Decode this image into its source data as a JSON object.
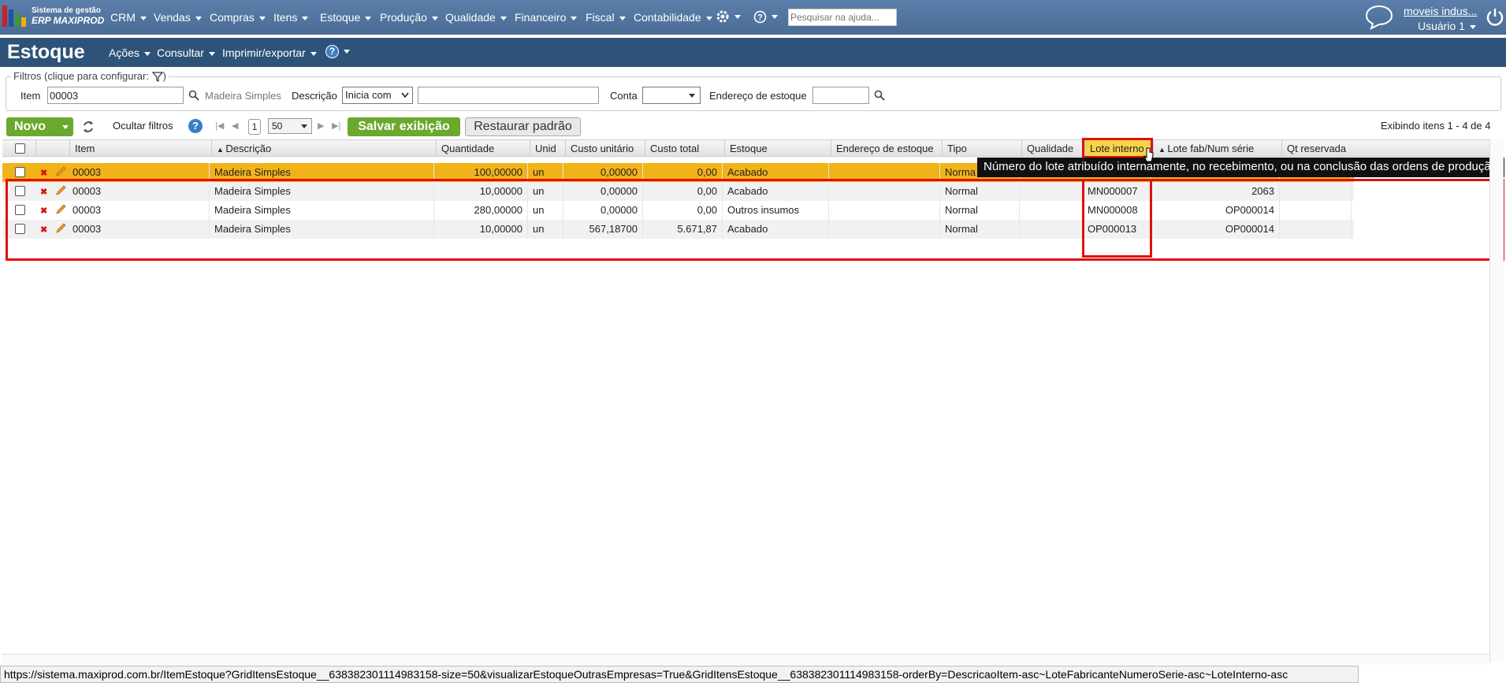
{
  "app": {
    "title_line1": "Sistema de gestão",
    "title_line2": "ERP MAXIPROD"
  },
  "menu": [
    "CRM",
    "Vendas",
    "Compras",
    "Itens",
    "Estoque",
    "Produção",
    "Qualidade",
    "Financeiro",
    "Fiscal",
    "Contabilidade"
  ],
  "search": {
    "placeholder": "Pesquisar na ajuda..."
  },
  "user": {
    "company": "moveis indus...",
    "name": "Usuário 1"
  },
  "page": {
    "title": "Estoque",
    "submenu": [
      "Ações",
      "Consultar",
      "Imprimir/exportar"
    ]
  },
  "filters": {
    "legend": "Filtros (clique para configurar:",
    "item_label": "Item",
    "item_value": "00003",
    "item_desc": "Madeira Simples",
    "desc_label": "Descrição",
    "desc_mode": "Inicia com",
    "desc_value": "",
    "conta_label": "Conta",
    "conta_value": "",
    "endereco_label": "Endereço de estoque",
    "endereco_value": ""
  },
  "toolbar": {
    "novo": "Novo",
    "ocultar": "Ocultar filtros",
    "page": "1",
    "page_size": "50",
    "salvar": "Salvar exibição",
    "restaurar": "Restaurar padrão",
    "exibindo": "Exibindo itens 1 - 4 de 4"
  },
  "columns": [
    "Item",
    "Descrição",
    "Quantidade",
    "Unid",
    "Custo unitário",
    "Custo total",
    "Estoque",
    "Endereço de estoque",
    "Tipo",
    "Qualidade",
    "Lote interno",
    "Lote fab/Num série",
    "Qt reservada"
  ],
  "rows": [
    {
      "item": "00003",
      "descricao": "Madeira Simples",
      "quantidade": "100,00000",
      "unid": "un",
      "custo_unit": "0,00000",
      "custo_total": "0,00",
      "estoque": "Acabado",
      "endereco": "",
      "tipo": "Norma",
      "qualidade": "",
      "lote_interno": "",
      "lote_fab": "",
      "qt_reservada": "",
      "highlight": true
    },
    {
      "item": "00003",
      "descricao": "Madeira Simples",
      "quantidade": "10,00000",
      "unid": "un",
      "custo_unit": "0,00000",
      "custo_total": "0,00",
      "estoque": "Acabado",
      "endereco": "",
      "tipo": "Normal",
      "qualidade": "",
      "lote_interno": "MN000007",
      "lote_fab": "2063",
      "qt_reservada": ""
    },
    {
      "item": "00003",
      "descricao": "Madeira Simples",
      "quantidade": "280,00000",
      "unid": "un",
      "custo_unit": "0,00000",
      "custo_total": "0,00",
      "estoque": "Outros insumos",
      "endereco": "",
      "tipo": "Normal",
      "qualidade": "",
      "lote_interno": "MN000008",
      "lote_fab": "OP000014",
      "qt_reservada": ""
    },
    {
      "item": "00003",
      "descricao": "Madeira Simples",
      "quantidade": "10,00000",
      "unid": "un",
      "custo_unit": "567,18700",
      "custo_total": "5.671,87",
      "estoque": "Acabado",
      "endereco": "",
      "tipo": "Normal",
      "qualidade": "",
      "lote_interno": "OP000013",
      "lote_fab": "OP000014",
      "qt_reservada": ""
    }
  ],
  "tooltip": "Número do lote atribuído internamente, no recebimento, ou na conclusão das ordens de produção.",
  "statusbar": "https://sistema.maxiprod.com.br/ItemEstoque?GridItensEstoque__638382301114983158-size=50&visualizarEstoqueOutrasEmpresas=True&GridItensEstoque__638382301114983158-orderBy=DescricaoItem-asc~LoteFabricanteNumeroSerie-asc~LoteInterno-asc",
  "colors": {
    "nav": "#4f74a0",
    "subbar": "#2e5378",
    "green": "#6aa82e",
    "highlight": "#f2b318",
    "red_box": "#e01010"
  }
}
